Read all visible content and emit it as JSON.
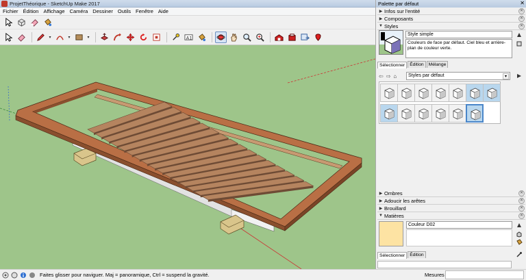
{
  "window": {
    "title": "ProjetThéorique - SketchUp Make 2017"
  },
  "menu": [
    {
      "label": "Fichier"
    },
    {
      "label": "Édition"
    },
    {
      "label": "Affichage"
    },
    {
      "label": "Caméra"
    },
    {
      "label": "Dessiner"
    },
    {
      "label": "Outils"
    },
    {
      "label": "Fenêtre"
    },
    {
      "label": "Aide"
    }
  ],
  "toolbar1_icons": [
    "select-arrow-icon",
    "make-component-icon",
    "eraser-icon",
    "paint-bucket-icon"
  ],
  "toolbar2_icons": [
    "select-icon",
    "eraser-icon",
    "pencil-line-icon",
    "arc-icon",
    "rectangle-icon",
    "push-pull-icon",
    "follow-me-icon",
    "move-icon",
    "rotate-icon",
    "scale-icon",
    "tape-measure-icon",
    "text-icon",
    "paint-bucket-icon",
    "orbit-icon",
    "pan-icon",
    "zoom-icon",
    "zoom-extents-icon",
    "warehouse-icon",
    "extension-warehouse-icon",
    "send-to-layout-icon",
    "extension-manager-icon"
  ],
  "status": {
    "message": "Faites glisser pour naviguer. Maj = panoramique, Ctrl =  suspend la gravité.",
    "measure_label": "Mesures",
    "measure_value": ""
  },
  "panel": {
    "title": "Palette par défaut",
    "trays": {
      "entity_info": "Infos sur l'entité",
      "components": "Composants",
      "styles": "Styles",
      "shadows": "Ombres",
      "soften_edges": "Adoucir les arêtes",
      "fog": "Brouillard",
      "materials": "Matières"
    },
    "styles": {
      "name": "Style simple",
      "description": "Couleurs de face par défaut. Ciel bleu et arrière-plan de couleur verte.",
      "tabs": [
        "Sélectionner",
        "Édition",
        "Mélange"
      ],
      "collection": "Styles par défaut",
      "thumbnails_count": 13
    },
    "materials": {
      "name": "Couleur D02",
      "swatch_color": "#fde3a3",
      "tabs": [
        "Sélectionner",
        "Édition"
      ]
    }
  },
  "colors": {
    "ground": "#9ec58a",
    "wood": "#b96f45",
    "wood_dark": "#8a4f2e",
    "plank": "#b5845f",
    "plank_dark": "#6e4b35",
    "block": "#d9c58b"
  }
}
